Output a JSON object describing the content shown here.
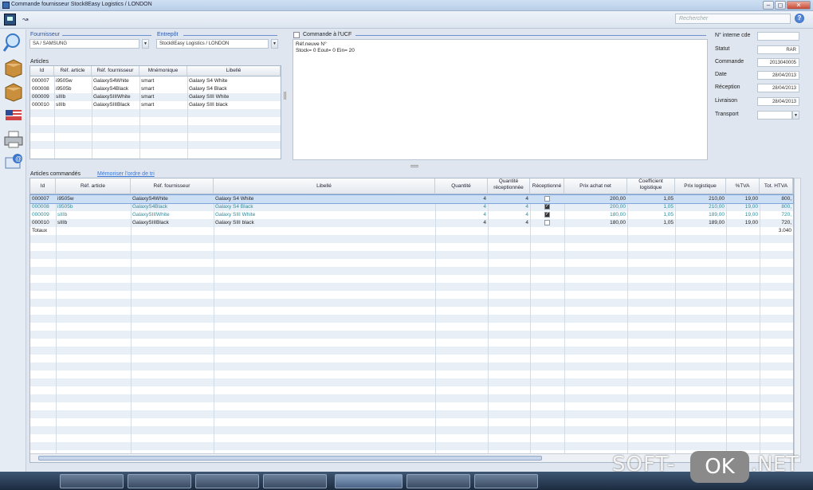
{
  "window": {
    "title": "Commande fournisseur Stock8Easy Logistics / LONDON"
  },
  "toolbar": {
    "search_placeholder": "Rechercher"
  },
  "header": {
    "fournisseur_label": "Fournisseur",
    "fournisseur_value": "SA / SAMSUNG",
    "entrepot_label": "Entrepôt",
    "entrepot_value": "Stock8Easy Logistics / LONDON",
    "commande_ucf_label": "Commande à l'UCF",
    "note_line1": "Réf.neuve N°",
    "note_line2": "Stock= 0 Eout= 0 Ein= 20"
  },
  "right_panel": {
    "fields": [
      {
        "label": "N° interne cde",
        "value": ""
      },
      {
        "label": "Statut",
        "value": "RAR"
      },
      {
        "label": "Commande",
        "value": "2013040005"
      },
      {
        "label": "Date",
        "value": "28/04/2013"
      },
      {
        "label": "Réception",
        "value": "28/04/2013"
      },
      {
        "label": "Livraison",
        "value": "28/04/2013"
      },
      {
        "label": "Transport",
        "value": ""
      }
    ]
  },
  "articles": {
    "title": "Articles",
    "columns": [
      "Id",
      "Réf. article",
      "Réf. fournisseur",
      "Mnémonique",
      "Libellé"
    ],
    "rows": [
      [
        "000007",
        "i9505w",
        "GalaxyS4White",
        "smart",
        "Galaxy S4 White"
      ],
      [
        "000008",
        "i9505b",
        "GalaxyS4Black",
        "smart",
        "Galaxy S4 Black"
      ],
      [
        "000009",
        "sIIIb",
        "GalaxySIIIWhite",
        "smart",
        "Galaxy SIII White"
      ],
      [
        "000010",
        "sIIIb",
        "GalaxySIIIBlack",
        "smart",
        "Galaxy SIII black"
      ]
    ]
  },
  "ordered": {
    "title": "Articles commandés",
    "memo_link": "Mémoriser l'ordre de tri",
    "columns": [
      "Id",
      "Réf. article",
      "Réf. fournisseur",
      "Libellé",
      "Quantité",
      "Quantité réceptionnée",
      "Réceptionné",
      "Prix achat net",
      "Coefficient logistique",
      "Prix logistique",
      "%TVA",
      "Tot. HTVA"
    ],
    "rows": [
      [
        "000007",
        "i9505w",
        "GalaxyS4White",
        "Galaxy S4 White",
        "4",
        "4",
        false,
        "200,00",
        "1,05",
        "210,00",
        "19,00",
        "800,"
      ],
      [
        "000008",
        "i9505b",
        "GalaxyS4Black",
        "Galaxy S4 Black",
        "4",
        "4",
        true,
        "200,00",
        "1,05",
        "210,00",
        "19,00",
        "800,"
      ],
      [
        "000009",
        "sIIIb",
        "GalaxySIIIWhite",
        "Galaxy SIII White",
        "4",
        "4",
        true,
        "180,00",
        "1,05",
        "189,00",
        "19,00",
        "720,"
      ],
      [
        "000010",
        "sIIIb",
        "GalaxySIIIBlack",
        "Galaxy SIII black",
        "4",
        "4",
        false,
        "180,00",
        "1,05",
        "189,00",
        "19,00",
        "720,"
      ]
    ],
    "totals_label": "Totaux",
    "totals_value": "3.040"
  },
  "watermark": {
    "left": "SOFT-",
    "ok": "OK",
    "right": ".NET"
  },
  "colors": {
    "accent": "#2a55a8",
    "teal_text": "#2f8a9a",
    "selection": "#cddff5"
  }
}
